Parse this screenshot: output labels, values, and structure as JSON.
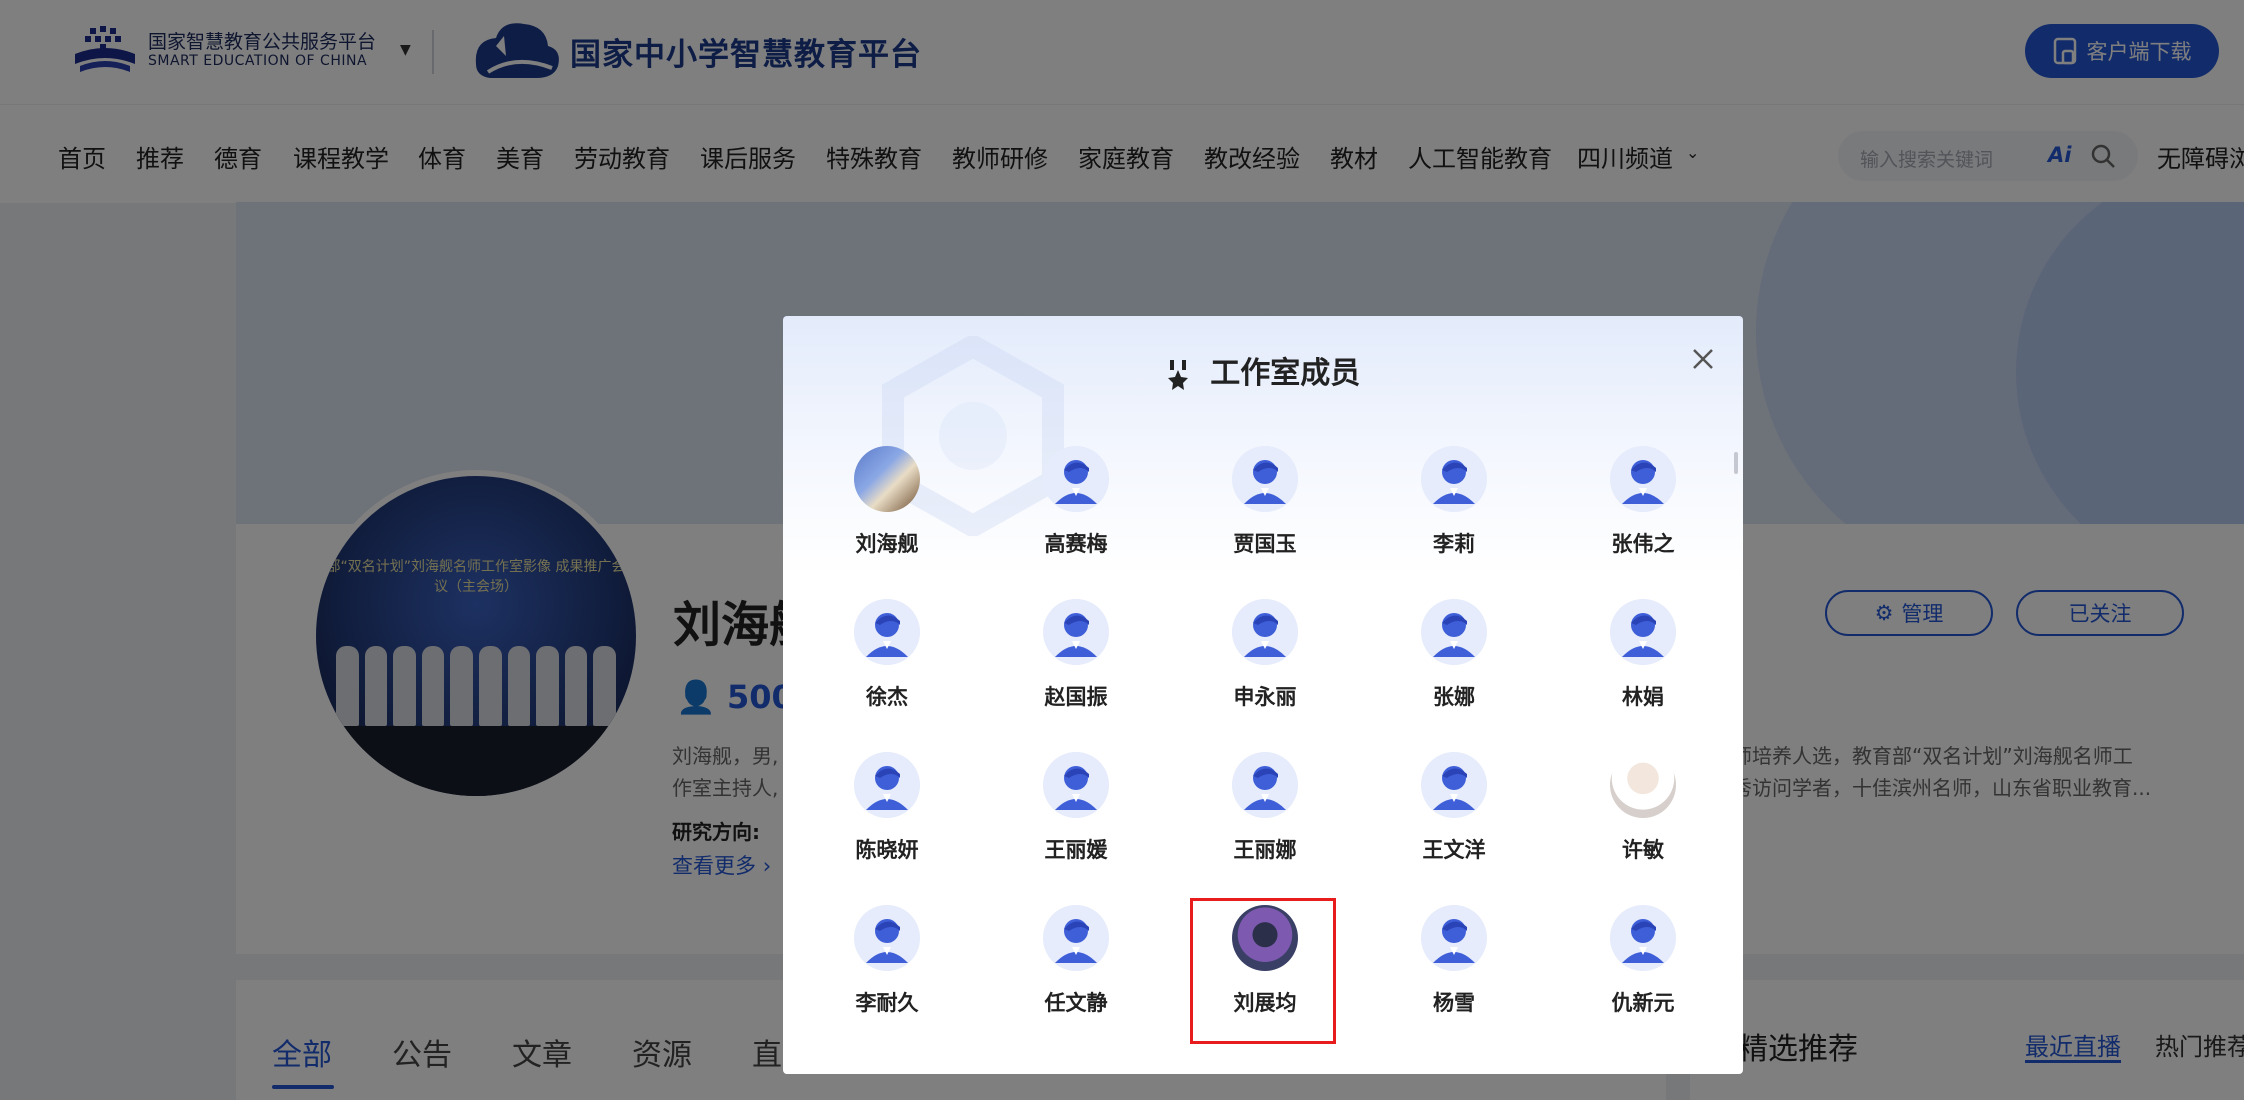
{
  "header": {
    "platform_cn": "国家智慧教育公共服务平台",
    "platform_en": "SMART EDUCATION OF CHINA",
    "site_title": "国家中小学智慧教育平台",
    "download_label": "客户端下载"
  },
  "nav": {
    "items": [
      "首页",
      "推荐",
      "德育",
      "课程教学",
      "体育",
      "美育",
      "劳动教育",
      "课后服务",
      "特殊教育",
      "教师研修",
      "家庭教育",
      "教改经验",
      "教材",
      "人工智能教育",
      "四川频道"
    ],
    "search_placeholder": "输入搜索关键词",
    "ai_label": "Ai",
    "accessibility": "无障碍浏"
  },
  "profile": {
    "name": "刘海舰",
    "fans": "500",
    "desc_line1": "刘海舰，男,",
    "desc_line2": "作室主持人,",
    "desc_right1": "师培养人选，教育部“双名计划”刘海舰名师工",
    "desc_right2": "秀访问学者，十佳滨州名师，山东省职业教育...",
    "research_label": "研究方向:",
    "more_label": "查看更多",
    "manage_label": "管理",
    "follow_label": "已关注",
    "photo_caption": "部“双名计划”刘海舰名师工作室影像 成果推广会议（主会场）"
  },
  "tabs": [
    "全部",
    "公告",
    "文章",
    "资源",
    "直"
  ],
  "recommend": {
    "title": "精选推荐",
    "tab_live": "最近直播",
    "tab_hot": "热门推荐"
  },
  "modal": {
    "title": "工作室成员",
    "members": [
      {
        "name": "刘海舰",
        "photo": "photo1"
      },
      {
        "name": "高赛梅",
        "photo": ""
      },
      {
        "name": "贾国玉",
        "photo": ""
      },
      {
        "name": "李莉",
        "photo": ""
      },
      {
        "name": "张伟之",
        "photo": ""
      },
      {
        "name": "徐杰",
        "photo": ""
      },
      {
        "name": "赵国振",
        "photo": ""
      },
      {
        "name": "申永丽",
        "photo": ""
      },
      {
        "name": "张娜",
        "photo": ""
      },
      {
        "name": "林娟",
        "photo": ""
      },
      {
        "name": "陈晓妍",
        "photo": ""
      },
      {
        "name": "王丽媛",
        "photo": ""
      },
      {
        "name": "王丽娜",
        "photo": ""
      },
      {
        "name": "王文洋",
        "photo": ""
      },
      {
        "name": "许敏",
        "photo": "photo2"
      },
      {
        "name": "李耐久",
        "photo": ""
      },
      {
        "name": "任文静",
        "photo": ""
      },
      {
        "name": "刘展均",
        "photo": "photo3",
        "highlighted": true
      },
      {
        "name": "杨雪",
        "photo": ""
      },
      {
        "name": "仇新元",
        "photo": ""
      }
    ]
  },
  "colors": {
    "brand_blue": "#2457d6",
    "highlight_red": "#e81c1c"
  }
}
